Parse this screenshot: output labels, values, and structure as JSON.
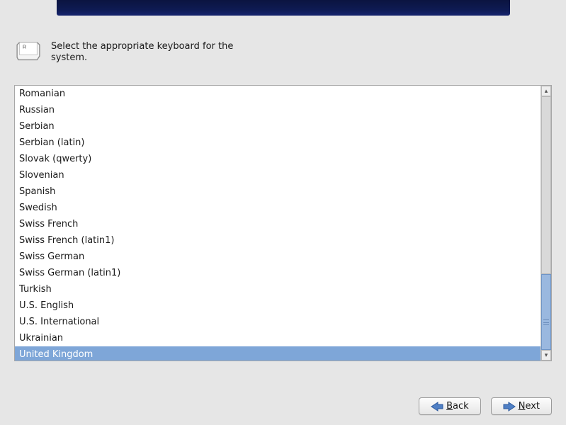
{
  "prompt": "Select the appropriate keyboard for the system.",
  "keyboard_icon_key_label": "R",
  "list": {
    "selected_index": 16,
    "items": [
      "Romanian",
      "Russian",
      "Serbian",
      "Serbian (latin)",
      "Slovak (qwerty)",
      "Slovenian",
      "Spanish",
      "Swedish",
      "Swiss French",
      "Swiss French (latin1)",
      "Swiss German",
      "Swiss German (latin1)",
      "Turkish",
      "U.S. English",
      "U.S. International",
      "Ukrainian",
      "United Kingdom"
    ]
  },
  "buttons": {
    "back": {
      "label": "Back",
      "mnemonic": "B"
    },
    "next": {
      "label": "Next",
      "mnemonic": "N"
    }
  }
}
